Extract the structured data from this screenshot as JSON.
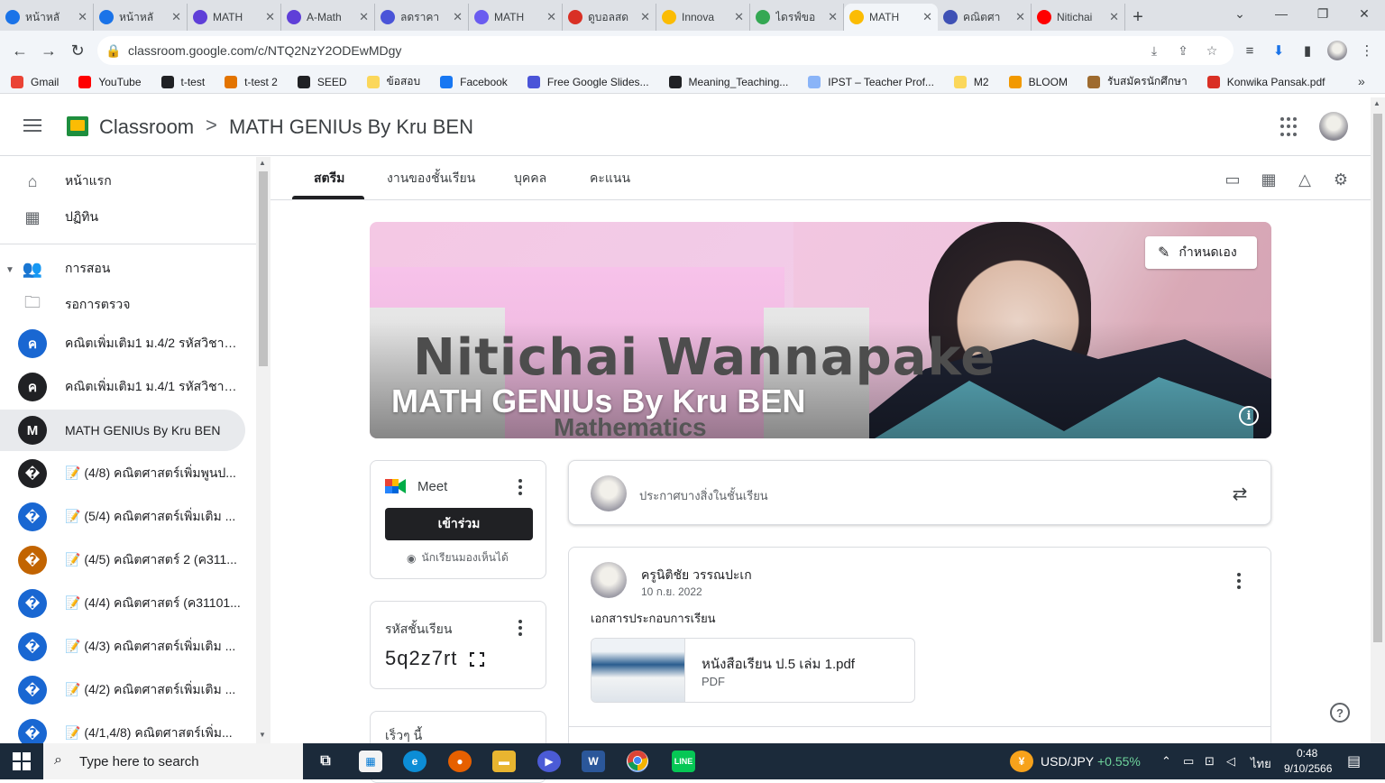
{
  "browser": {
    "tabs": [
      {
        "title": "หน้าหลั",
        "color": "#1a73e8",
        "active": false
      },
      {
        "title": "หน้าหลั",
        "color": "#1a73e8",
        "active": false
      },
      {
        "title": "MATH",
        "color": "#5f3fd8",
        "active": false
      },
      {
        "title": "A-Math",
        "color": "#5f3fd8",
        "active": false
      },
      {
        "title": "ลดราคา",
        "color": "#4a54d8",
        "active": false
      },
      {
        "title": "MATH",
        "color": "#6a5cf0",
        "active": false
      },
      {
        "title": "ดูบอลสด",
        "color": "#d93025",
        "active": false
      },
      {
        "title": "Innova",
        "color": "#fbbc04",
        "active": false
      },
      {
        "title": "ไดรฟ์ขอ",
        "color": "#34a853",
        "active": false
      },
      {
        "title": "MATH",
        "color": "#fbbc04",
        "active": true
      },
      {
        "title": "คณิตศา",
        "color": "#3f51b5",
        "active": false
      },
      {
        "title": "Nitichai",
        "color": "#ff0000",
        "active": false
      }
    ],
    "url": "classroom.google.com/c/NTQ2NzY2ODEwMDgy",
    "bookmarks": [
      {
        "label": "Gmail",
        "color": "#ea4335"
      },
      {
        "label": "YouTube",
        "color": "#ff0000"
      },
      {
        "label": "t-test",
        "color": "#202124"
      },
      {
        "label": "t-test 2",
        "color": "#e37400"
      },
      {
        "label": "SEED",
        "color": "#202124"
      },
      {
        "label": "ข้อสอบ",
        "color": "#fbd75b"
      },
      {
        "label": "Facebook",
        "color": "#1877f2"
      },
      {
        "label": "Free Google Slides...",
        "color": "#4a54d8"
      },
      {
        "label": "Meaning_Teaching...",
        "color": "#202124"
      },
      {
        "label": "IPST – Teacher Prof...",
        "color": "#8ab4f8"
      },
      {
        "label": "M2",
        "color": "#fbd75b"
      },
      {
        "label": "BLOOM",
        "color": "#f29900"
      },
      {
        "label": "รับสมัครนักศึกษา",
        "color": "#9e6b2f"
      },
      {
        "label": "Konwika Pansak.pdf",
        "color": "#d93025"
      }
    ],
    "bookmarks_more": "»"
  },
  "header": {
    "app_name": "Classroom",
    "separator": ">",
    "class_name": "MATH GENIUs By Kru BEN"
  },
  "sidebar": {
    "home": "หน้าแรก",
    "calendar": "ปฏิทิน",
    "teaching": "การสอน",
    "to_review": "รอการตรวจ",
    "classes": [
      {
        "letter": "ค",
        "label": "คณิตเพิ่มเติม1 ม.4/2 รหัสวิชาค...",
        "color": "#1967d2",
        "selected": false
      },
      {
        "letter": "ค",
        "label": "คณิตเพิ่มเติม1 ม.4/1 รหัสวิชาค...",
        "color": "#202124",
        "selected": false
      },
      {
        "letter": "M",
        "label": "MATH GENIUs By Kru BEN",
        "color": "#202124",
        "selected": true
      },
      {
        "letter": "�",
        "label": "📝 (4/8) คณิตศาสตร์เพิ่มพูนป...",
        "color": "#202124",
        "selected": false
      },
      {
        "letter": "�",
        "label": "📝 (5/4) คณิตศาสตร์เพิ่มเติม ...",
        "color": "#1967d2",
        "selected": false
      },
      {
        "letter": "�",
        "label": "📝 (4/5) คณิตศาสตร์ 2 (ค311...",
        "color": "#c26401",
        "selected": false
      },
      {
        "letter": "�",
        "label": "📝 (4/4) คณิตศาสตร์ (ค31101...",
        "color": "#1967d2",
        "selected": false
      },
      {
        "letter": "�",
        "label": "📝 (4/3) คณิตศาสตร์เพิ่มเติม ...",
        "color": "#1967d2",
        "selected": false
      },
      {
        "letter": "�",
        "label": "📝 (4/2) คณิตศาสตร์เพิ่มเติม ...",
        "color": "#1967d2",
        "selected": false
      },
      {
        "letter": "�",
        "label": "📝 (4/1,4/8) คณิตศาสตร์เพิ่ม...",
        "color": "#1967d2",
        "selected": false
      }
    ]
  },
  "class_tabs": [
    "สตรีม",
    "งานของชั้นเรียน",
    "บุคคล",
    "คะแนน"
  ],
  "banner": {
    "title": "MATH GENIUs By Kru BEN",
    "artwork_name": "Nitichai Wannapake",
    "artwork_sub": "Mathematics",
    "customize_label": "กำหนดเอง"
  },
  "meet": {
    "label": "Meet",
    "join_label": "เข้าร่วม",
    "visibility_note": "นักเรียนมองเห็นได้"
  },
  "class_code": {
    "label": "รหัสชั้นเรียน",
    "value": "5q2z7rt"
  },
  "upcoming": {
    "label": "เร็วๆ นี้"
  },
  "announce": {
    "placeholder": "ประกาศบางสิ่งในชั้นเรียน"
  },
  "post": {
    "author": "ครูนิติชัย วรรณปะเก",
    "date": "10 ก.ย. 2022",
    "text": "เอกสารประกอบการเรียน",
    "attachment_name": "หนังสือเรียน ป.5 เล่ม 1.pdf",
    "attachment_type": "PDF"
  },
  "taskbar": {
    "search_placeholder": "Type here to search",
    "fx_pair": "USD/JPY",
    "fx_change": "+0.55%",
    "lang": "ไทย",
    "time": "0:48",
    "date": "9/10/2566"
  }
}
